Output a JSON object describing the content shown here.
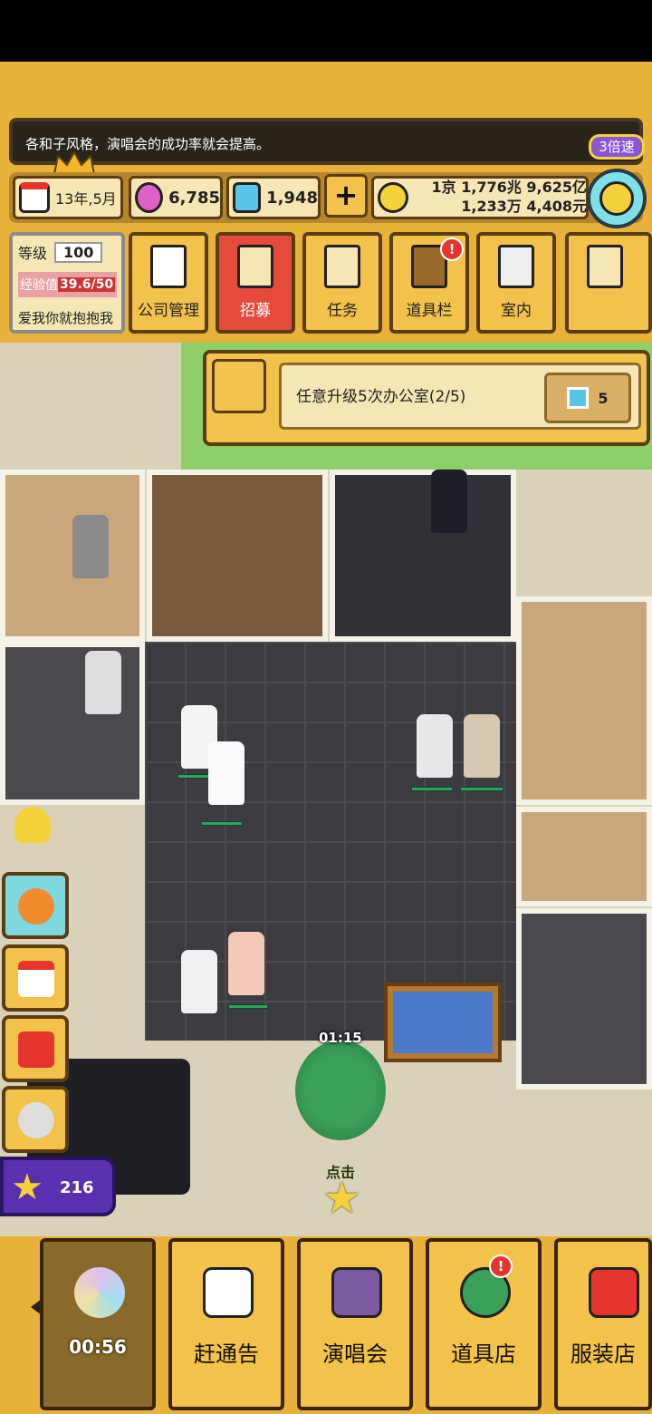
{
  "tip": {
    "text": "各和子风格，演唱会的成功率就会提高。",
    "speed_badge": "3倍速"
  },
  "resources": {
    "date": "13年,5月",
    "pink_currency": "6,785",
    "gems": "1,948",
    "money_line1": "1京 1,776兆 9,625亿",
    "money_line2": "1,233万 4,408元"
  },
  "level_panel": {
    "level_label": "等级",
    "level_value": "100",
    "exp_label": "经验值",
    "exp_value": "39.6/50",
    "company_name": "爱我你就抱抱我"
  },
  "menu": {
    "company": "公司管理",
    "recruit": "招募",
    "quest": "任务",
    "inventory": "道具栏",
    "interior": "室内",
    "inventory_badge": "!"
  },
  "quest_banner": {
    "text": "任意升级5次办公室(2/5)",
    "reward": "5"
  },
  "side": {
    "stars": "216"
  },
  "scene": {
    "timer": "01:15",
    "tap": "点击"
  },
  "bottom": {
    "disc_timer": "00:56",
    "schedule": "赶通告",
    "concert": "演唱会",
    "item_shop": "道具店",
    "clothing_shop": "服装店",
    "item_shop_badge": "!"
  }
}
